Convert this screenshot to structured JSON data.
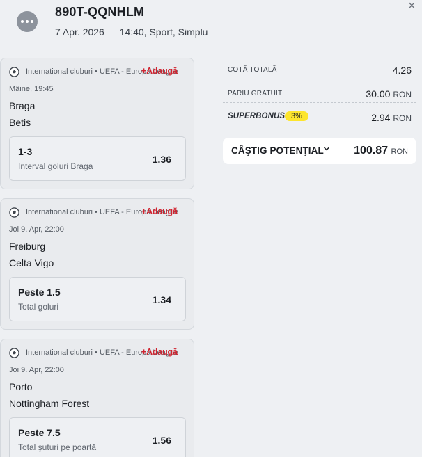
{
  "header": {
    "ticket_id": "890T-QQNHLM",
    "meta": "7 Apr. 2026 — 14:40, Sport, Simplu",
    "close_symbol": "×"
  },
  "icons": {
    "menu": "more-dots-icon",
    "sport": "soccer-ball-icon",
    "close": "close-icon",
    "expand": "chevron-down-icon"
  },
  "colors": {
    "add_red": "#d0232f",
    "superbonus_yellow": "#fde52d"
  },
  "bets": [
    {
      "competition": "International cluburi • UEFA - Europa League",
      "add_label": "Adaugă",
      "datetime": "Mâine, 19:45",
      "home": "Braga",
      "away": "Betis",
      "selection": "1-3",
      "market": "Interval goluri Braga",
      "odd": "1.36"
    },
    {
      "competition": "International cluburi • UEFA - Europa League",
      "add_label": "Adaugă",
      "datetime": "Joi 9. Apr, 22:00",
      "home": "Freiburg",
      "away": "Celta Vigo",
      "selection": "Peste 1.5",
      "market": "Total goluri",
      "odd": "1.34"
    },
    {
      "competition": "International cluburi • UEFA - Europa League",
      "add_label": "Adaugă",
      "datetime": "Joi 9. Apr, 22:00",
      "home": "Porto",
      "away": "Nottingham Forest",
      "selection": "Peste 7.5",
      "market": "Total şuturi pe poartă",
      "odd": "1.56"
    }
  ],
  "summary": {
    "total_odds_label": "COTĂ TOTALĂ",
    "total_odds": "4.26",
    "free_bet_label": "PARIU GRATUIT",
    "free_bet_value": "30.00",
    "currency": "RON",
    "superbonus_label": "SUPERBONUS",
    "superbonus_pct": "3%",
    "superbonus_value": "2.94",
    "potential_label": "CÂŞTIG POTENŢIAL",
    "potential_value": "100.87"
  }
}
